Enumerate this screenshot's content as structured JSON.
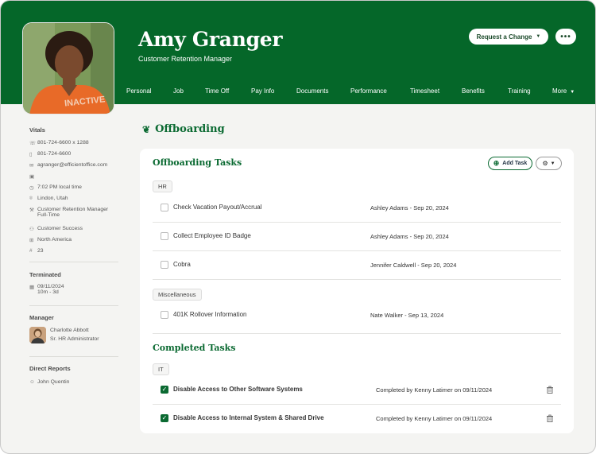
{
  "profile": {
    "name": "Amy Granger",
    "job_title": "Customer Retention Manager",
    "status_stamp": "INACTIVE"
  },
  "header_actions": {
    "request_change_label": "Request a Change",
    "more_label": "•••"
  },
  "tabs": [
    {
      "label": "Personal"
    },
    {
      "label": "Job"
    },
    {
      "label": "Time Off"
    },
    {
      "label": "Pay Info"
    },
    {
      "label": "Documents"
    },
    {
      "label": "Performance"
    },
    {
      "label": "Timesheet"
    },
    {
      "label": "Benefits"
    },
    {
      "label": "Training"
    },
    {
      "label": "More"
    }
  ],
  "sidebar": {
    "vitals_title": "Vitals",
    "vitals": [
      {
        "icon": "phone-icon",
        "text": "801-724-6600 x 1288"
      },
      {
        "icon": "mobile-icon",
        "text": "801-724-6600"
      },
      {
        "icon": "email-icon",
        "text": "agranger@efficientoffice.com"
      },
      {
        "icon": "linkedin-icon",
        "text": ""
      },
      {
        "icon": "clock-icon",
        "text": "7:02 PM local time"
      },
      {
        "icon": "location-icon",
        "text": "Lindon, Utah"
      },
      {
        "icon": "wrench-icon",
        "text": "Customer Retention Manager",
        "text2": "Full-Time"
      },
      {
        "icon": "people-icon",
        "text": "Customer Success"
      },
      {
        "icon": "org-icon",
        "text": "North America"
      },
      {
        "icon": "hash-icon",
        "text": "23"
      }
    ],
    "terminated_title": "Terminated",
    "terminated_date": "09/11/2024",
    "terminated_duration": "10m - 3d",
    "manager_title": "Manager",
    "manager_name": "Charlotte Abbott",
    "manager_role": "Sr. HR Administrator",
    "direct_reports_title": "Direct Reports",
    "direct_report_name": "John Quentin"
  },
  "main": {
    "section_title": "Offboarding",
    "card_title": "Offboarding Tasks",
    "add_task_label": "Add Task",
    "groups": [
      {
        "tag": "HR",
        "tasks": [
          {
            "name": "Check Vacation Payout/Accrual",
            "assignee": "Ashley Adams - Sep 20, 2024"
          },
          {
            "name": "Collect Employee ID Badge",
            "assignee": "Ashley Adams - Sep 20, 2024"
          },
          {
            "name": "Cobra",
            "assignee": "Jennifer Caldwell - Sep 20, 2024"
          }
        ]
      },
      {
        "tag": "Miscellaneous",
        "tasks": [
          {
            "name": "401K Rollover Information",
            "assignee": "Nate Walker - Sep 13, 2024"
          }
        ]
      }
    ],
    "completed_title": "Completed Tasks",
    "completed_group_tag": "IT",
    "completed_tasks": [
      {
        "name": "Disable Access to Other Software Systems",
        "completed_by": "Completed by Kenny Latimer on 09/11/2024"
      },
      {
        "name": "Disable Access to Internal System & Shared Drive",
        "completed_by": "Completed by Kenny Latimer on 09/11/2024"
      }
    ]
  },
  "colors": {
    "brand_green": "#056729",
    "accent_green": "#0b6a32",
    "stamp_orange": "#e86a28"
  }
}
